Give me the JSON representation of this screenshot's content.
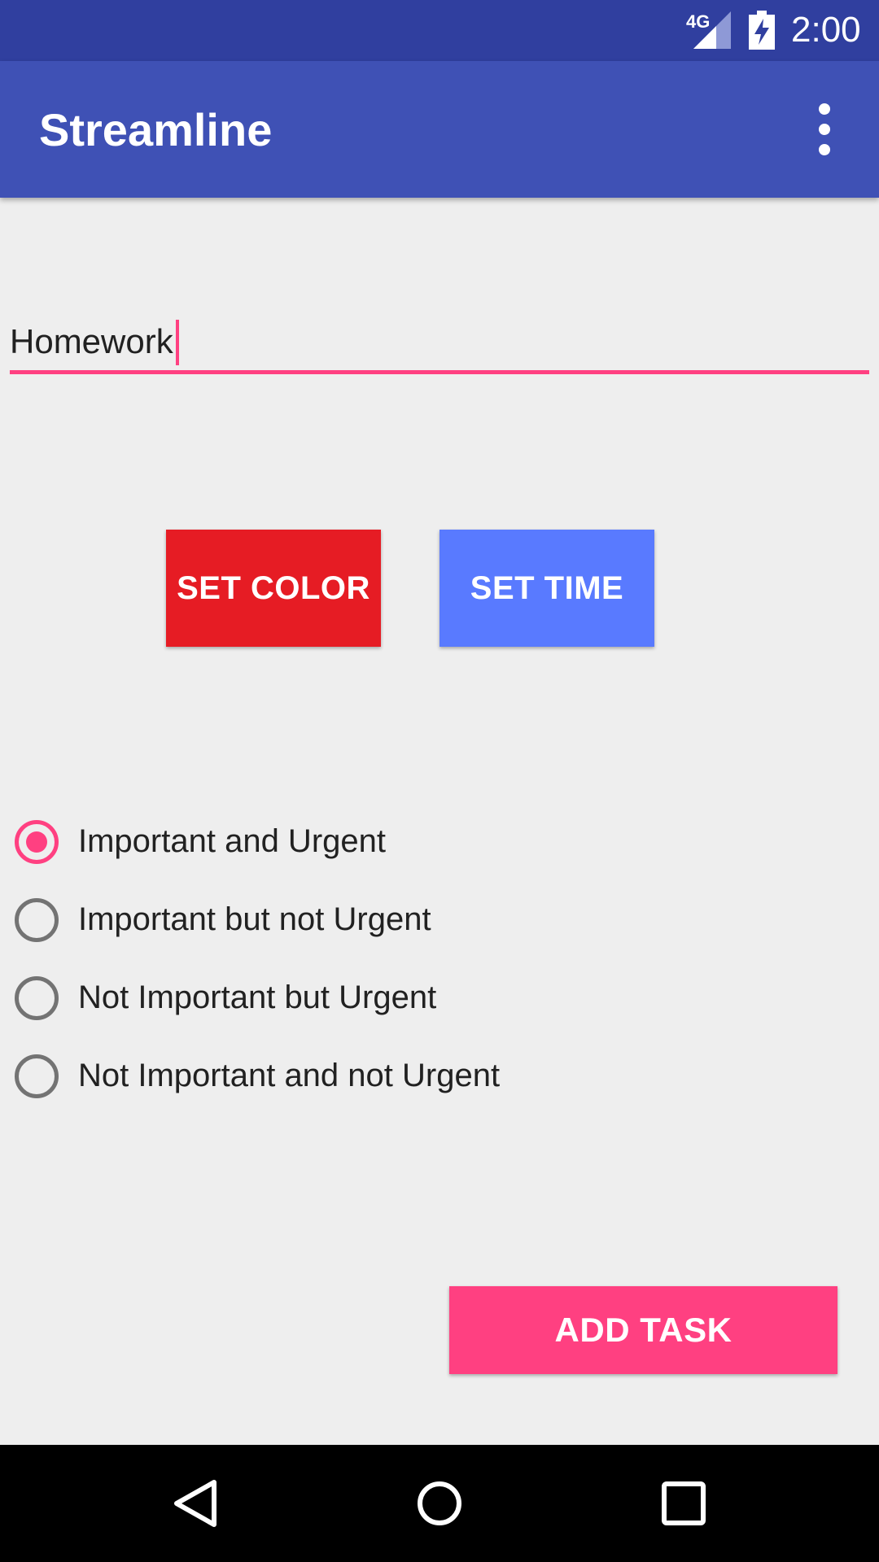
{
  "status_bar": {
    "network": "4G",
    "time": "2:00",
    "icons": [
      "signal-icon",
      "battery-charging-icon"
    ]
  },
  "app_bar": {
    "title": "Streamline",
    "overflow_icon": "more-vert-icon"
  },
  "task_input": {
    "value": "Homework",
    "accent_color": "#ff4081"
  },
  "buttons": {
    "set_color": "SET COLOR",
    "set_time": "SET TIME",
    "add_task": "ADD TASK"
  },
  "colors": {
    "primary": "#3f51b5",
    "primary_dark": "#303f9f",
    "accent": "#ff4081",
    "set_color_bg": "#e61c24",
    "set_time_bg": "#597aff"
  },
  "priority_options": [
    {
      "label": "Important and Urgent",
      "checked": true
    },
    {
      "label": "Important but not Urgent",
      "checked": false
    },
    {
      "label": "Not Important but Urgent",
      "checked": false
    },
    {
      "label": "Not Important and not Urgent",
      "checked": false
    }
  ],
  "nav_bar": {
    "icons": [
      "back-icon",
      "home-icon",
      "recents-icon"
    ]
  }
}
